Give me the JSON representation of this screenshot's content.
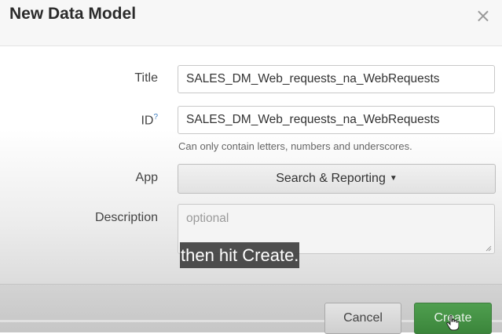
{
  "modal": {
    "title": "New Data Model",
    "close_icon": "close-icon",
    "close_glyph": "×"
  },
  "form": {
    "title_label": "Title",
    "title_value": "SALES_DM_Web_requests_na_WebRequests",
    "id_label": "ID",
    "id_help_mark": "?",
    "id_value": "SALES_DM_Web_requests_na_WebRequests",
    "id_help_text": "Can only contain letters, numbers and underscores.",
    "app_label": "App",
    "app_value": "Search & Reporting",
    "description_label": "Description",
    "description_placeholder": "optional"
  },
  "caption": {
    "text": "then hit Create."
  },
  "footer": {
    "cancel_label": "Cancel",
    "create_label": "Create"
  },
  "colors": {
    "create_button": "#3b853b",
    "header_bg": "#f7f7f7",
    "help_link": "#3b7bbf"
  }
}
